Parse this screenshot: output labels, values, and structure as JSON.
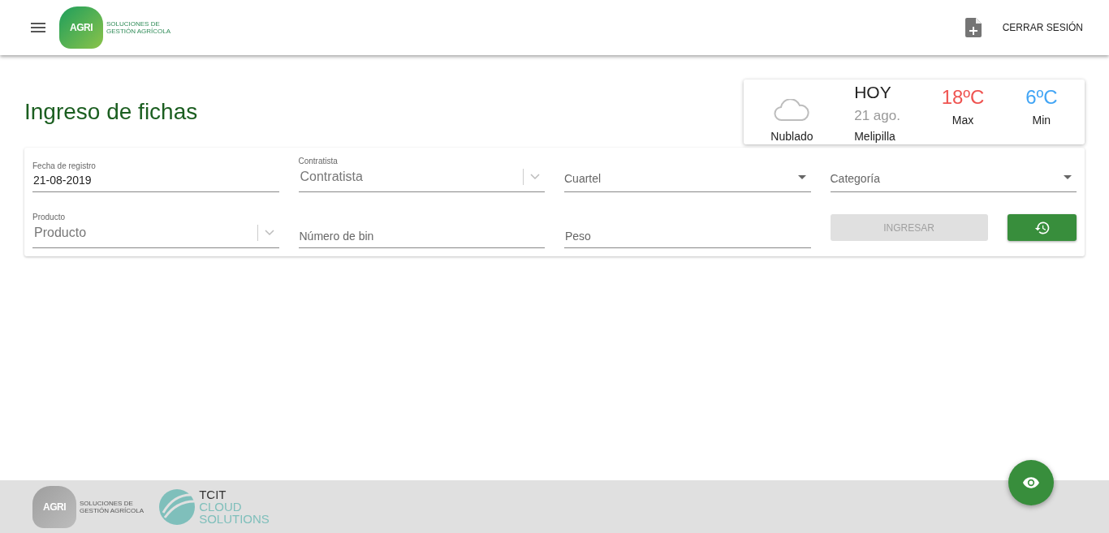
{
  "header": {
    "logo": {
      "mark": "AGRI",
      "tagline_1": "SOLUCIONES DE",
      "tagline_2": "GESTIÓN AGRÍCOLA"
    },
    "logout": "CERRAR SESIÓN"
  },
  "title": "Ingreso de fichas",
  "weather": {
    "condition": "Nublado",
    "day": "HOY",
    "date": "21 ago.",
    "place": "Melipilla",
    "temps": [
      {
        "value": "18ºC",
        "label": "Max",
        "color": "#ef5350"
      },
      {
        "value": "6ºC",
        "label": "Min",
        "color": "#42a5f5"
      }
    ]
  },
  "fields": [
    {
      "kind": "input",
      "label": "Fecha de registro",
      "value": "21-08-2019"
    },
    {
      "kind": "select",
      "label": "Contratista",
      "placeholder": "Contratista"
    },
    {
      "kind": "dropdown",
      "placeholder": "Cuartel"
    },
    {
      "kind": "dropdown",
      "placeholder": "Categoría"
    },
    {
      "kind": "select",
      "label": "Producto",
      "placeholder": "Producto"
    },
    {
      "kind": "input",
      "placeholder": "Número de bin"
    },
    {
      "kind": "input",
      "placeholder": "Peso"
    }
  ],
  "submit": {
    "label": "INGRESAR",
    "disabled": true
  },
  "footer": {
    "logo": {
      "mark": "AGRI",
      "tagline_1": "SOLUCIONES DE",
      "tagline_2": "GESTIÓN AGRÍCOLA"
    },
    "partner": {
      "line_1": "TCIT",
      "line_2": "CLOUD",
      "line_3": "SOLUTIONS"
    }
  }
}
